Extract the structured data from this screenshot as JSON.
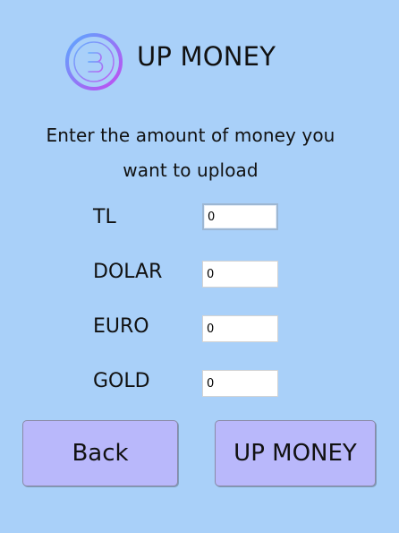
{
  "header": {
    "logo_icon": "bitcoin-coin-icon",
    "title": "UP MONEY"
  },
  "instruction": {
    "line1": "Enter the amount of money you",
    "line2": "want to upload"
  },
  "fields": [
    {
      "label": "TL",
      "value": "0"
    },
    {
      "label": "DOLAR",
      "value": "0"
    },
    {
      "label": "EURO",
      "value": "0"
    },
    {
      "label": "GOLD",
      "value": "0"
    }
  ],
  "buttons": {
    "back_label": "Back",
    "submit_label": "UP MONEY"
  },
  "colors": {
    "background": "#a9d0f9",
    "button": "#b9b8fb",
    "logo_gradient_start": "#5aa9ff",
    "logo_gradient_end": "#c34bf0"
  }
}
